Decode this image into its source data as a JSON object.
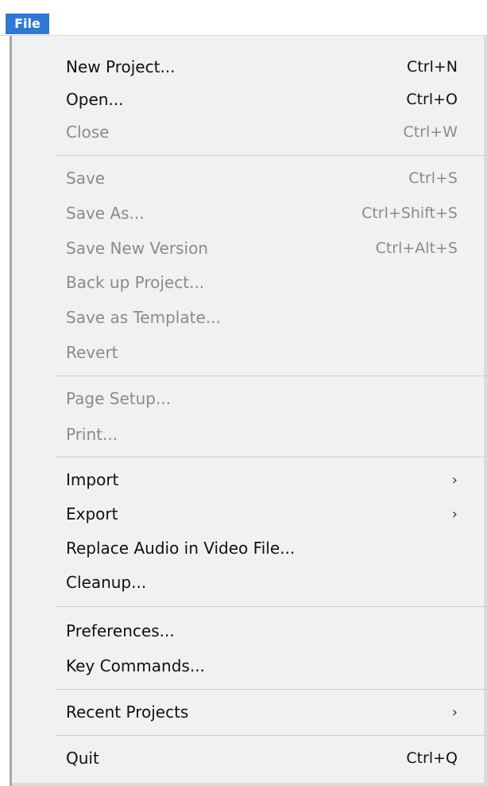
{
  "menubar": {
    "file_label": "File"
  },
  "menu": {
    "new_project": {
      "label": "New Project...",
      "shortcut": "Ctrl+N"
    },
    "open": {
      "label": "Open...",
      "shortcut": "Ctrl+O"
    },
    "close": {
      "label": "Close",
      "shortcut": "Ctrl+W"
    },
    "save": {
      "label": "Save",
      "shortcut": "Ctrl+S"
    },
    "save_as": {
      "label": "Save As...",
      "shortcut": "Ctrl+Shift+S"
    },
    "save_new_version": {
      "label": "Save New Version",
      "shortcut": "Ctrl+Alt+S"
    },
    "back_up_project": {
      "label": "Back up Project..."
    },
    "save_as_template": {
      "label": "Save as Template..."
    },
    "revert": {
      "label": "Revert"
    },
    "page_setup": {
      "label": "Page Setup..."
    },
    "print": {
      "label": "Print..."
    },
    "import": {
      "label": "Import",
      "submenu_icon": "chevron-right-icon"
    },
    "export": {
      "label": "Export",
      "submenu_icon": "chevron-right-icon"
    },
    "replace_audio": {
      "label": "Replace Audio in Video File..."
    },
    "cleanup": {
      "label": "Cleanup..."
    },
    "preferences": {
      "label": "Preferences..."
    },
    "key_commands": {
      "label": "Key Commands..."
    },
    "recent_projects": {
      "label": "Recent Projects",
      "submenu_icon": "chevron-right-icon"
    },
    "quit": {
      "label": "Quit",
      "shortcut": "Ctrl+Q"
    }
  },
  "colors": {
    "menu_background": "#f1f1f1",
    "enabled_text": "#111111",
    "disabled_text": "#8b8b8b",
    "file_highlight": "#2f78d4",
    "separator": "#cfcfcf"
  }
}
